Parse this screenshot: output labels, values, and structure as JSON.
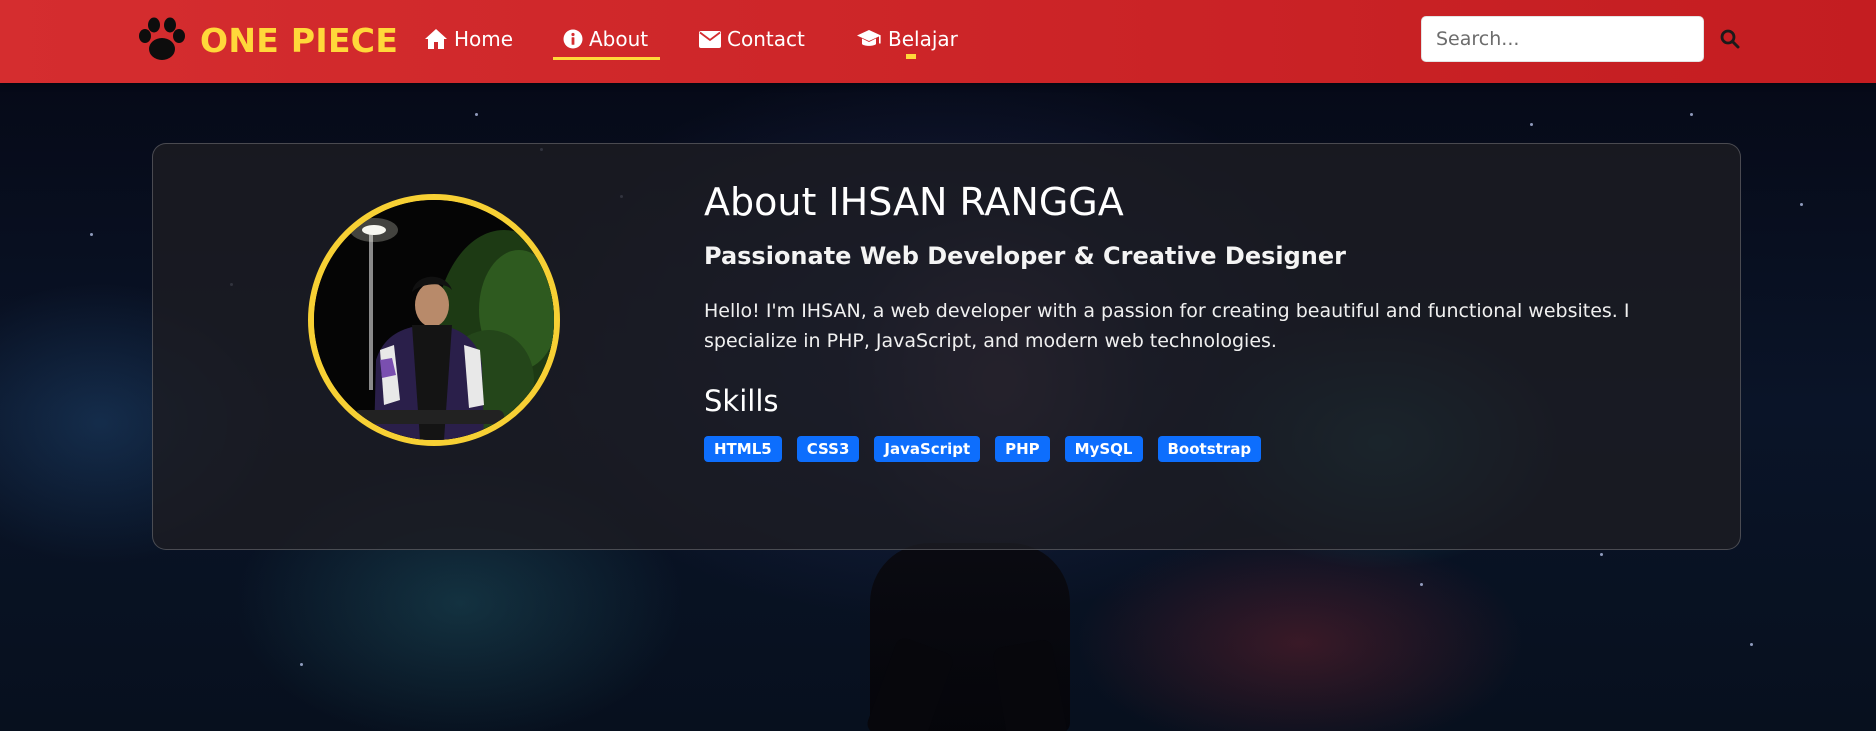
{
  "brand": {
    "name": "ONE PIECE",
    "icon": "paw-icon",
    "color": "#ffd83a"
  },
  "nav": {
    "items": [
      {
        "label": "Home",
        "icon": "home-icon"
      },
      {
        "label": "About",
        "icon": "info-circle-icon",
        "active": true
      },
      {
        "label": "Contact",
        "icon": "envelope-icon"
      },
      {
        "label": "Belajar",
        "icon": "graduation-cap-icon"
      }
    ],
    "active_indicator_color": "#ffd83a",
    "background": "#d52d2f"
  },
  "search": {
    "placeholder": "Search...",
    "value": "",
    "button_icon": "search-icon"
  },
  "about": {
    "title": "About IHSAN RANGGA",
    "subtitle": "Passionate Web Developer & Creative Designer",
    "description": "Hello! I'm IHSAN, a web developer with a passion for creating beautiful and functional websites. I specialize in PHP, JavaScript, and modern web technologies.",
    "skills_title": "Skills",
    "skills": [
      "HTML5",
      "CSS3",
      "JavaScript",
      "PHP",
      "MySQL",
      "Bootstrap"
    ],
    "avatar_border_color": "#f7d034",
    "skill_badge_color": "#0d6efd"
  }
}
